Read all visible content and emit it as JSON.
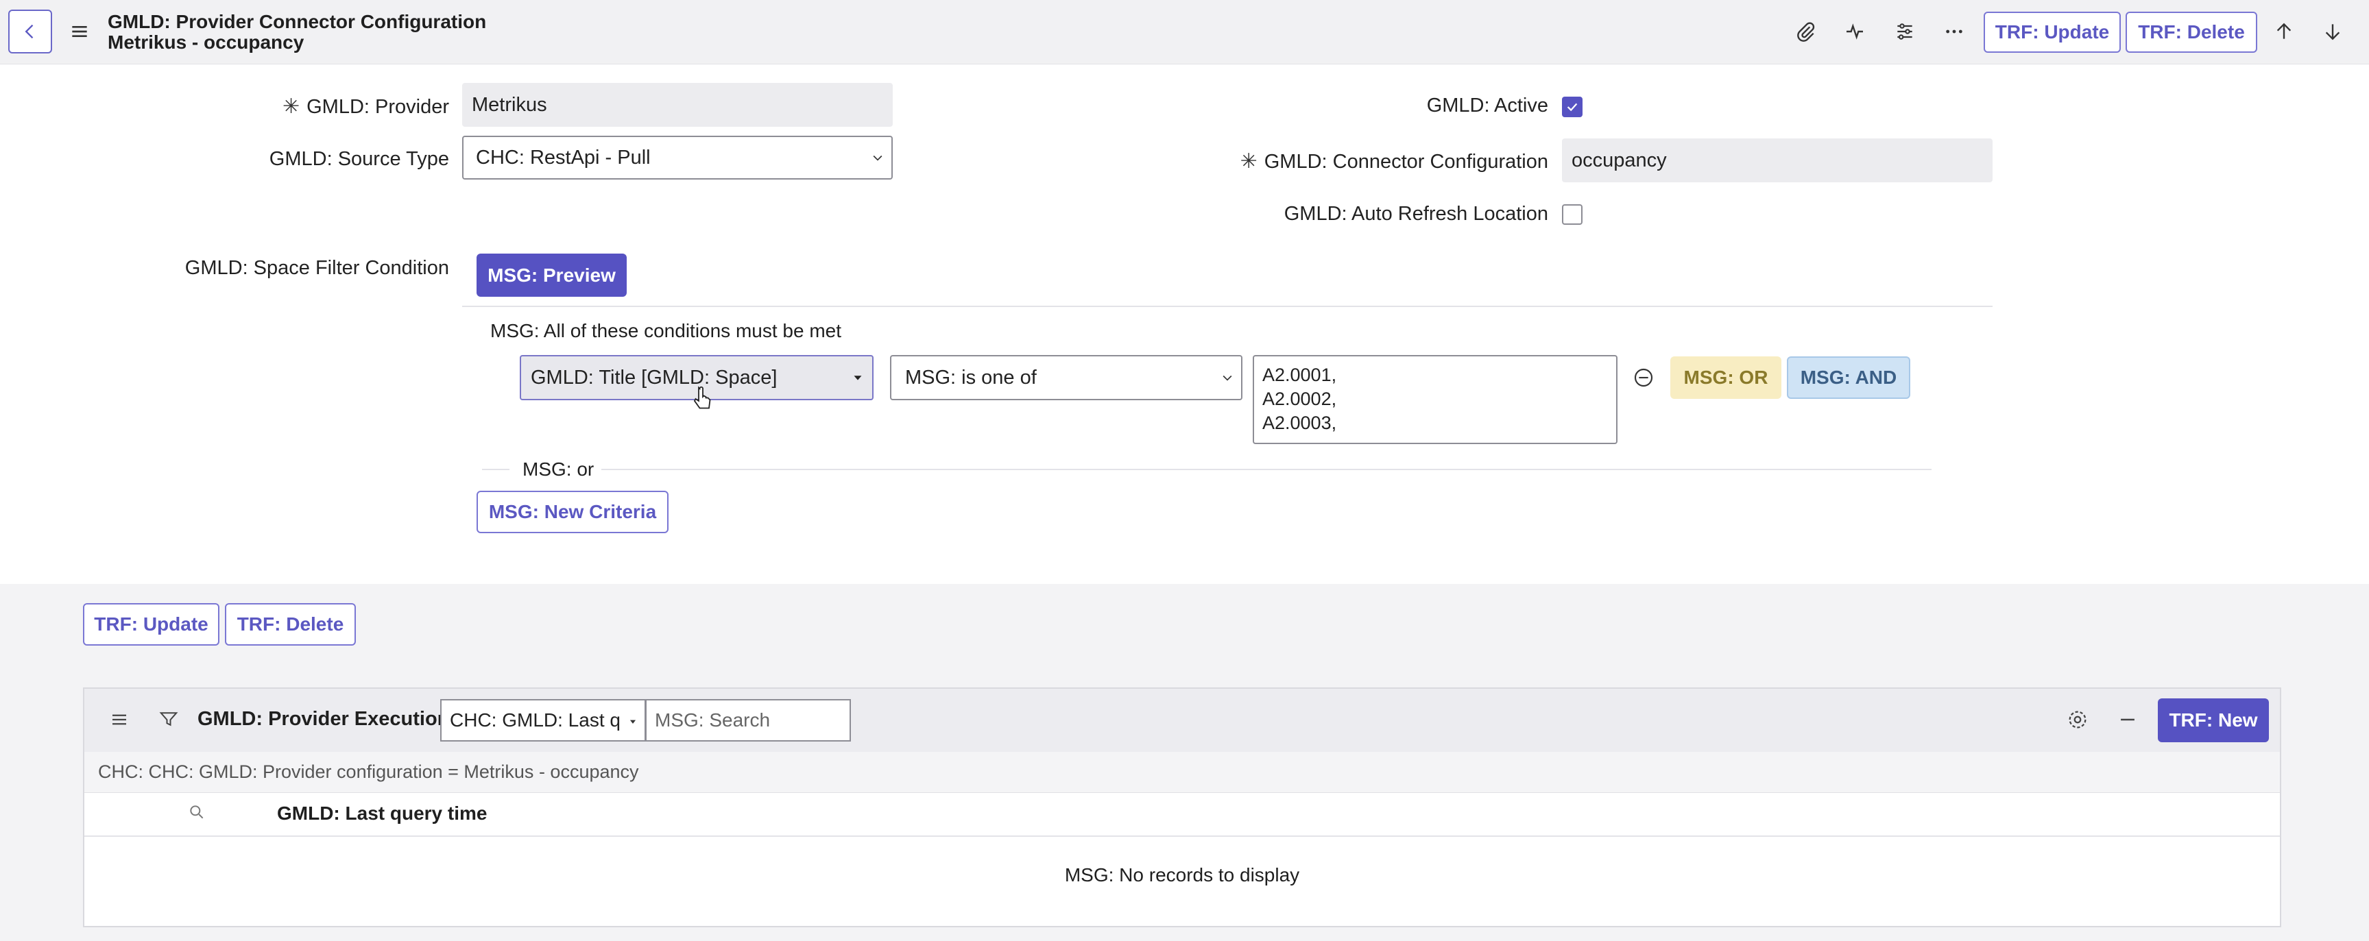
{
  "header": {
    "title_line1": "GMLD: Provider Connector Configuration",
    "title_line2": "Metrikus - occupancy",
    "update_label": "TRF: Update",
    "delete_label": "TRF: Delete",
    "icons": [
      "back-icon",
      "menu-icon",
      "paperclip-icon",
      "activity-icon",
      "sliders-icon",
      "more-icon",
      "arrow-up-icon",
      "arrow-down-icon"
    ]
  },
  "form": {
    "provider": {
      "label": "GMLD: Provider",
      "value": "Metrikus"
    },
    "source_type": {
      "label": "GMLD: Source Type",
      "value": "CHC: RestApi - Pull"
    },
    "active": {
      "label": "GMLD: Active",
      "checked": true
    },
    "connector_config": {
      "label": "GMLD: Connector Configuration",
      "value": "occupancy"
    },
    "auto_refresh": {
      "label": "GMLD: Auto Refresh Location",
      "checked": false
    },
    "space_filter": {
      "label": "GMLD: Space Filter Condition"
    }
  },
  "condition": {
    "preview_label": "MSG: Preview",
    "all_conditions_text": "MSG: All of these conditions must be met",
    "field_value": "GMLD: Title [GMLD: Space]",
    "operator_value": "MSG: is one of",
    "values_lines": [
      "A2.0001,",
      "A2.0002,",
      "A2.0003,"
    ],
    "or_button": "MSG: OR",
    "and_button": "MSG: AND",
    "or_divider_text": "MSG: or",
    "new_criteria_label": "MSG: New Criteria"
  },
  "bottom_buttons": {
    "update_label": "TRF: Update",
    "delete_label": "TRF: Delete"
  },
  "related_list": {
    "title": "GMLD: Provider Executions",
    "search_field_select": "CHC: GMLD: Last qu",
    "search_placeholder": "MSG: Search",
    "new_label": "TRF: New",
    "filter_breadcrumb": "CHC: CHC: GMLD: Provider configuration = Metrikus - occupancy",
    "column_header": "GMLD: Last query time",
    "empty_message": "MSG: No records to display"
  },
  "colors": {
    "accent": "#5652c2",
    "or_pill": "#f8edc2",
    "and_pill": "#cfe3f5"
  }
}
